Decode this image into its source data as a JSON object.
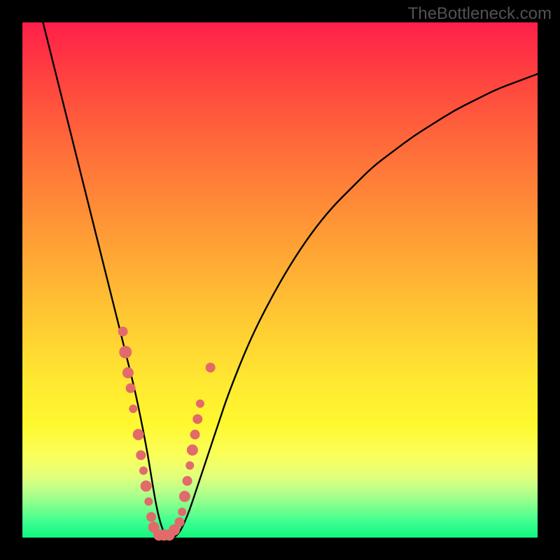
{
  "watermark": "TheBottleneck.com",
  "chart_data": {
    "type": "line",
    "title": "",
    "xlabel": "",
    "ylabel": "",
    "xlim": [
      0,
      100
    ],
    "ylim": [
      0,
      100
    ],
    "curve": {
      "name": "bottleneck-curve",
      "x": [
        4,
        6,
        8,
        10,
        12,
        14,
        16,
        18,
        20,
        22,
        24,
        25,
        26,
        27,
        28,
        30,
        32,
        34,
        36,
        38,
        40,
        44,
        48,
        52,
        56,
        60,
        64,
        68,
        72,
        76,
        80,
        84,
        88,
        92,
        96,
        100
      ],
      "y": [
        100,
        92,
        84,
        76,
        68,
        60,
        52,
        44,
        36,
        28,
        18,
        12,
        6,
        2,
        0,
        0,
        4,
        10,
        16,
        22,
        28,
        38,
        46,
        53,
        59,
        64,
        68,
        72,
        75,
        78,
        80.5,
        83,
        85,
        87,
        88.5,
        90
      ]
    },
    "datapoints": {
      "name": "measured-points",
      "color": "#e26a6a",
      "points": [
        {
          "x": 19.5,
          "y": 40,
          "r": 7
        },
        {
          "x": 20,
          "y": 36,
          "r": 9
        },
        {
          "x": 20.5,
          "y": 32,
          "r": 8
        },
        {
          "x": 21,
          "y": 29,
          "r": 7
        },
        {
          "x": 21.5,
          "y": 25,
          "r": 6
        },
        {
          "x": 22.5,
          "y": 20,
          "r": 8
        },
        {
          "x": 23,
          "y": 16,
          "r": 7
        },
        {
          "x": 23.5,
          "y": 13,
          "r": 6
        },
        {
          "x": 24,
          "y": 10,
          "r": 8
        },
        {
          "x": 24.5,
          "y": 7,
          "r": 6
        },
        {
          "x": 25,
          "y": 4,
          "r": 7
        },
        {
          "x": 25.5,
          "y": 2,
          "r": 8
        },
        {
          "x": 26.5,
          "y": 0.5,
          "r": 8
        },
        {
          "x": 27.5,
          "y": 0.5,
          "r": 8
        },
        {
          "x": 28.5,
          "y": 0.5,
          "r": 8
        },
        {
          "x": 29.5,
          "y": 1.5,
          "r": 8
        },
        {
          "x": 30.5,
          "y": 3,
          "r": 7
        },
        {
          "x": 31,
          "y": 5,
          "r": 6
        },
        {
          "x": 31.5,
          "y": 8,
          "r": 8
        },
        {
          "x": 32,
          "y": 11,
          "r": 7
        },
        {
          "x": 32.5,
          "y": 14,
          "r": 6
        },
        {
          "x": 33,
          "y": 17,
          "r": 8
        },
        {
          "x": 33.5,
          "y": 20,
          "r": 7
        },
        {
          "x": 34,
          "y": 23,
          "r": 7
        },
        {
          "x": 34.5,
          "y": 26,
          "r": 6
        },
        {
          "x": 36.5,
          "y": 33,
          "r": 7
        }
      ]
    }
  }
}
